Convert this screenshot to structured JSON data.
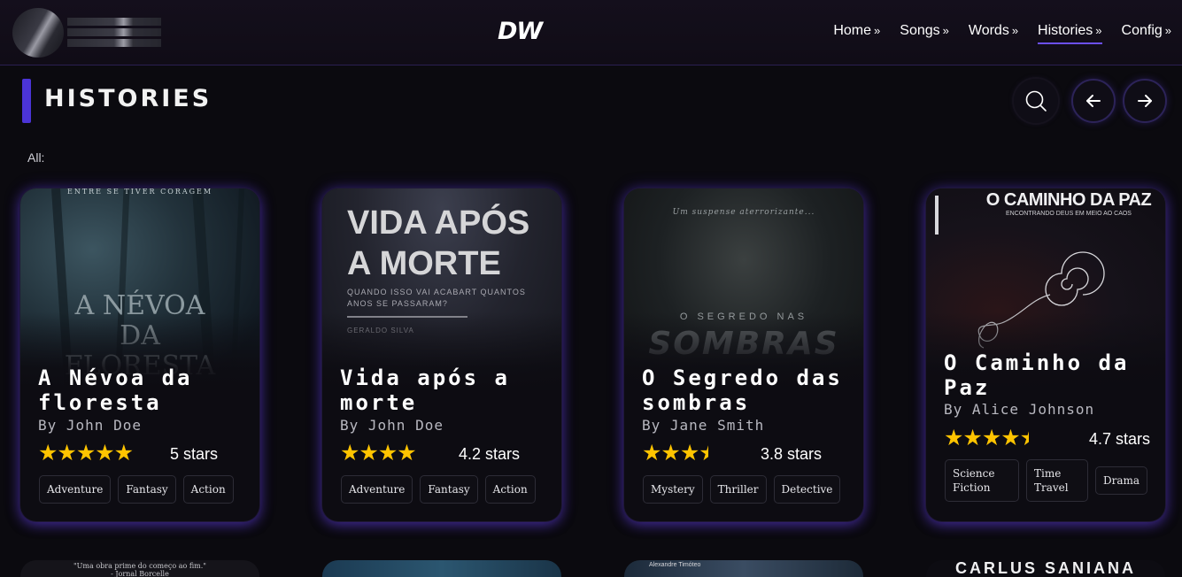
{
  "nav": {
    "logo": "DW",
    "items": [
      {
        "label": "Home",
        "arrow": "»"
      },
      {
        "label": "Songs",
        "arrow": "»"
      },
      {
        "label": "Words",
        "arrow": "»"
      },
      {
        "label": "Histories",
        "arrow": "»"
      },
      {
        "label": "Config",
        "arrow": "»"
      }
    ],
    "active": "Histories"
  },
  "header": {
    "title": "HISTORIES",
    "filter_label": "All:"
  },
  "colors": {
    "accent": "#4b34d6",
    "star": "#ffc400",
    "background": "#0b0a0f"
  },
  "cards": [
    {
      "cover_lines": [
        "ENTRE SE TIVER CORAGEM",
        "A NÉVOA",
        "DA",
        "FLORESTA"
      ],
      "title": "A Névoa da floresta",
      "author": "By John Doe",
      "stars": 5,
      "rating_text": "5 stars",
      "tags": [
        "Adventure",
        "Fantasy",
        "Action"
      ]
    },
    {
      "cover_lines": [
        "VIDA APÓS",
        "A MORTE",
        "QUANDO ISSO VAI ACABART QUANTOS",
        "ANOS SE PASSARAM?",
        "GERALDO SILVA"
      ],
      "title": "Vida após a morte",
      "author": "By John Doe",
      "stars": 4.2,
      "rating_text": "4.2 stars",
      "tags": [
        "Adventure",
        "Fantasy",
        "Action"
      ]
    },
    {
      "cover_lines": [
        "Um suspense aterrorizante...",
        "O SEGREDO NAS",
        "SOMBRAS"
      ],
      "title": "O Segredo das sombras",
      "author": "By Jane Smith",
      "stars": 3.8,
      "rating_text": "3.8 stars",
      "tags": [
        "Mystery",
        "Thriller",
        "Detective"
      ]
    },
    {
      "cover_lines": [
        "O CAMINHO DA PAZ",
        "ENCONTRANDO DEUS EM MEIO AO CAOS"
      ],
      "title": "O Caminho da Paz",
      "author": "By Alice Johnson",
      "stars": 4.7,
      "rating_text": "4.7 stars",
      "tags": [
        "Science Fiction",
        "Time Travel",
        "Drama"
      ]
    }
  ],
  "bottom_covers": [
    {
      "lines": [
        "\"Uma obra prime do começo ao fim.\"",
        "- Jornal Borcelle"
      ]
    },
    {
      "lines": []
    },
    {
      "lines": [
        "Alexandre Timóteo"
      ]
    },
    {
      "lines": [
        "CARLUS SANIANA"
      ]
    }
  ]
}
